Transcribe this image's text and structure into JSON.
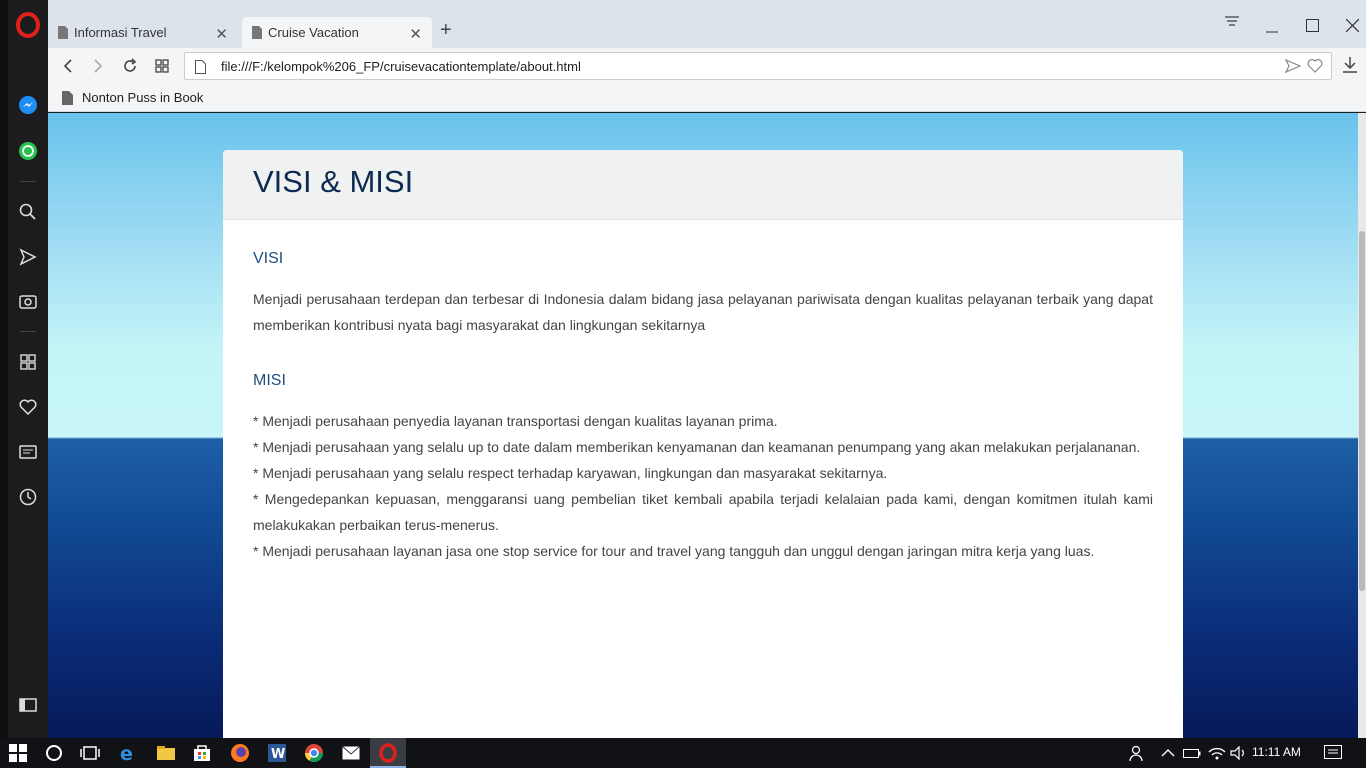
{
  "browser": {
    "tabs": [
      {
        "title": "Informasi Travel",
        "active": false
      },
      {
        "title": "Cruise Vacation",
        "active": true
      }
    ],
    "url": "file:///F:/kelompok%206_FP/cruisevacationtemplate/about.html",
    "bookmark": "Nonton Puss in Book"
  },
  "page": {
    "heading": "VISI & MISI",
    "visi_title": "VISI",
    "visi_text": "Menjadi perusahaan terdepan dan terbesar di Indonesia dalam bidang jasa pelayanan pariwisata dengan kualitas pelayanan terbaik yang dapat memberikan kontribusi nyata bagi masyarakat dan lingkungan sekitarnya",
    "misi_title": "MISI",
    "misi_items": [
      "* Menjadi perusahaan penyedia layanan transportasi dengan kualitas layanan prima.",
      "* Menjadi perusahaan yang selalu up to date dalam memberikan kenyamanan dan keamanan penumpang yang akan melakukan perjalananan.",
      "* Menjadi perusahaan yang selalu respect terhadap karyawan, lingkungan dan masyarakat sekitarnya.",
      "* Mengedepankan kepuasan, menggaransi uang pembelian tiket kembali apabila terjadi kelalaian pada kami, dengan komitmen itulah kami melakukakan perbaikan terus-menerus.",
      "* Menjadi perusahaan layanan jasa one stop service for tour and travel yang tangguh dan unggul dengan jaringan mitra kerja yang luas."
    ]
  },
  "taskbar": {
    "time": "11:11 AM",
    "pinned": [
      "start-icon",
      "cortana-icon",
      "task-view-icon",
      "edge-icon",
      "file-explorer-icon",
      "store-icon",
      "firefox-icon",
      "word-icon",
      "chrome-icon",
      "mail-icon",
      "opera-icon"
    ]
  },
  "colors": {
    "opera_red": "#e0201b",
    "heading": "#0d2a52",
    "subheading": "#1f4f7c"
  }
}
